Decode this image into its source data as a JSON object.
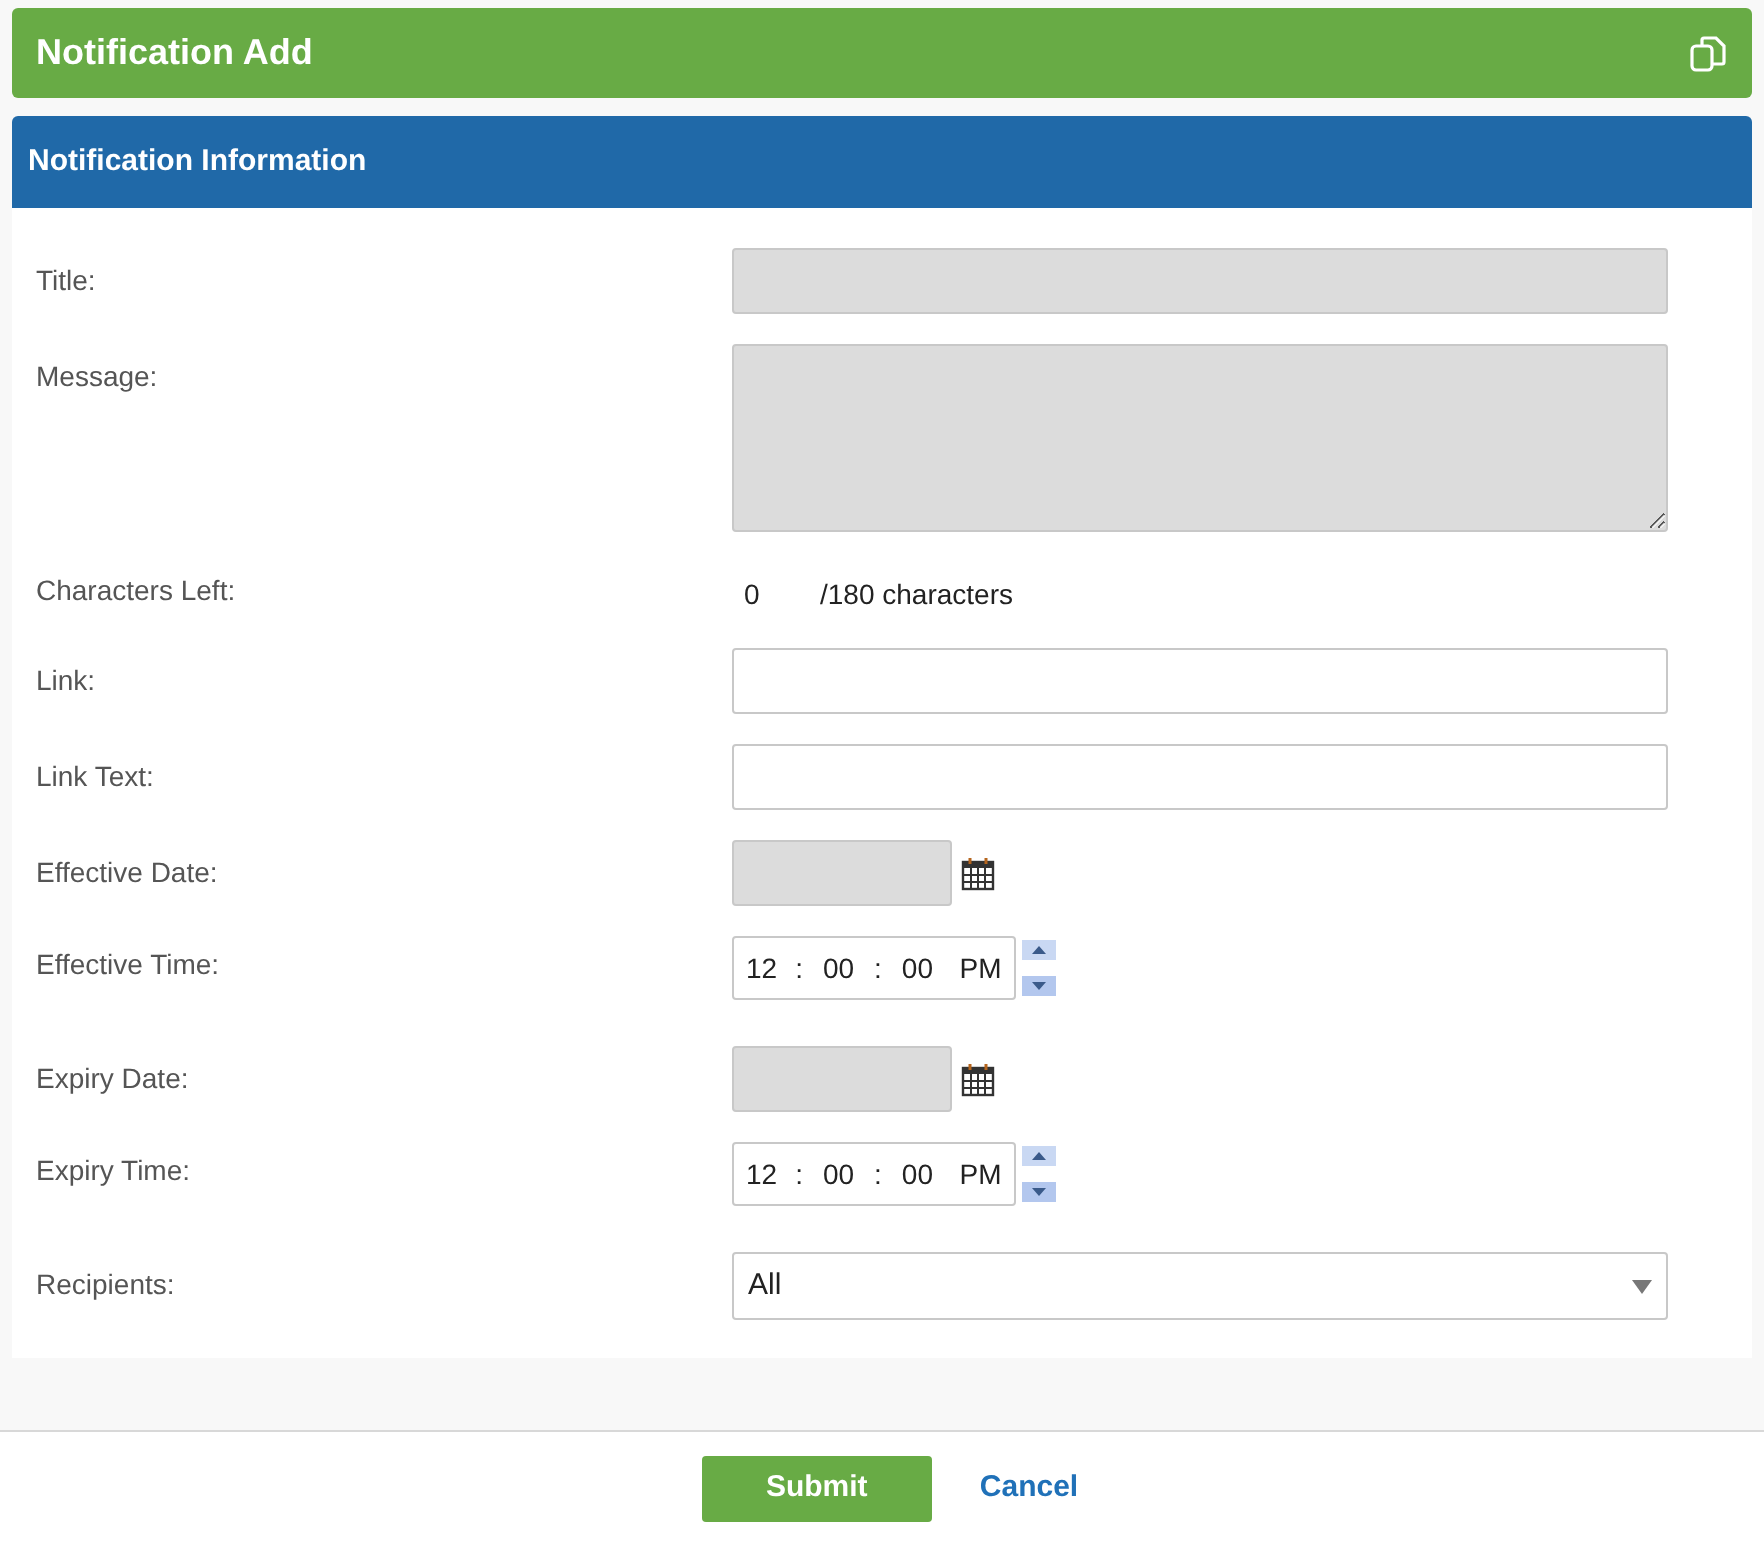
{
  "header": {
    "title": "Notification Add"
  },
  "section": {
    "title": "Notification Information"
  },
  "fields": [
    {
      "kind": "input",
      "label": "Title:",
      "disabled": true
    },
    {
      "kind": "textarea",
      "label": "Message:",
      "disabled": true
    },
    {
      "kind": "counter",
      "label": "Characters Left:",
      "count": "0",
      "suffix": "/180 characters"
    },
    {
      "kind": "input",
      "label": "Link:",
      "disabled": false
    },
    {
      "kind": "input",
      "label": "Link Text:",
      "disabled": false
    },
    {
      "kind": "date",
      "label": "Effective Date:",
      "disabled": true
    },
    {
      "kind": "time",
      "label": "Effective Time:",
      "parts": [
        "12",
        "00",
        "00",
        "PM"
      ],
      "separator": ":"
    },
    {
      "kind": "date",
      "label": "Expiry Date:",
      "disabled": true
    },
    {
      "kind": "time",
      "label": "Expiry Time:",
      "parts": [
        "12",
        "00",
        "00",
        "PM"
      ],
      "separator": ":"
    },
    {
      "kind": "select",
      "label": "Recipients:",
      "value": "All"
    }
  ],
  "buttons": {
    "submit": "Submit",
    "cancel": "Cancel"
  }
}
